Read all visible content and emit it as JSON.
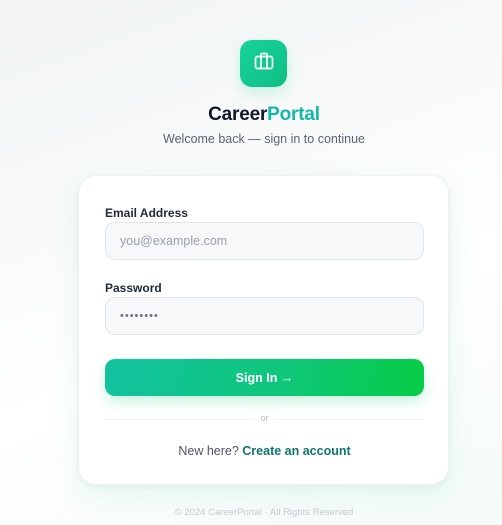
{
  "brand": {
    "name_part1": "Career",
    "name_part2": "Portal",
    "icon": "briefcase-icon",
    "tagline": "Welcome back — sign in to continue"
  },
  "form": {
    "email_label": "Email Address",
    "email_placeholder": "you@example.com",
    "email_value": "",
    "password_label": "Password",
    "password_value": "••••••••",
    "submit_label": "Sign In →",
    "divider_text": "or",
    "signup_prompt": "New here?",
    "signup_link": "Create an account"
  },
  "footer": {
    "text": "© 2024 CareerPortal · All Rights Reserved"
  },
  "colors": {
    "accent": "#14b8a6",
    "button_start": "#12c2a0",
    "button_end": "#05cc45",
    "link": "#0f766e"
  }
}
